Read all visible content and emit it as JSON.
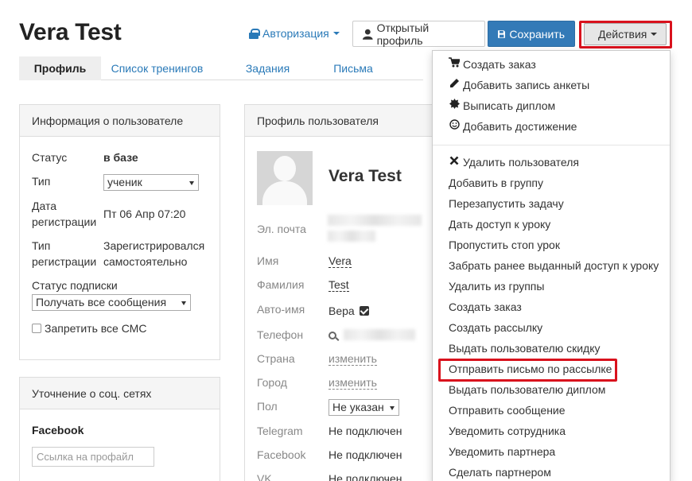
{
  "header": {
    "title": "Vera Test",
    "auth_label": "Авторизация",
    "open_profile_label": "Открытый профиль",
    "save_label": "Сохранить",
    "actions_label": "Действия"
  },
  "tabs": [
    {
      "label": "Профиль",
      "active": true
    },
    {
      "label": "Список тренингов",
      "active": false
    },
    {
      "label": "Задания",
      "active": false
    },
    {
      "label": "Письма",
      "active": false
    }
  ],
  "user_info": {
    "heading": "Информация о пользователе",
    "status_label": "Статус",
    "status_value": "в базе",
    "type_label": "Тип",
    "type_value": "ученик",
    "reg_date_label_1": "Дата",
    "reg_date_label_2": "регистрации",
    "reg_date_value": "Пт 06 Апр 07:20",
    "reg_type_label_1": "Тип",
    "reg_type_label_2": "регистрации",
    "reg_type_value_1": "Зарегистрировался",
    "reg_type_value_2": "самостоятельно",
    "subscription_label": "Статус подписки",
    "subscription_value": "Получать все сообщения",
    "no_sms_label": "Запретить все СМС"
  },
  "social": {
    "heading": "Уточнение о соц. сетях",
    "facebook_label": "Facebook",
    "facebook_placeholder": "Ссылка на профайл"
  },
  "profile": {
    "heading": "Профиль пользователя",
    "name": "Vera Test",
    "email_label": "Эл. почта",
    "first_name_label": "Имя",
    "first_name_value": "Vera",
    "last_name_label": "Фамилия",
    "last_name_value": "Test",
    "auto_name_label": "Авто-имя",
    "auto_name_value": "Вера",
    "phone_label": "Телефон",
    "country_label": "Страна",
    "country_value": "изменить",
    "city_label": "Город",
    "city_value": "изменить",
    "gender_label": "Пол",
    "gender_value": "Не указан",
    "telegram_label": "Telegram",
    "telegram_value": "Не подключен",
    "facebook_label": "Facebook",
    "facebook_value": "Не подключен",
    "vk_label": "VK",
    "vk_value": "Не подключен"
  },
  "actions_menu": {
    "group1": [
      {
        "label": "Создать заказ",
        "icon": "cart-icon"
      },
      {
        "label": "Добавить запись анкеты",
        "icon": "pencil-icon"
      },
      {
        "label": "Выписать диплом",
        "icon": "certificate-icon"
      },
      {
        "label": "Добавить достижение",
        "icon": "smile-icon"
      }
    ],
    "group2": [
      {
        "label": "Удалить пользователя",
        "icon": "close-icon"
      },
      {
        "label": "Добавить в группу"
      },
      {
        "label": "Перезапустить задачу"
      },
      {
        "label": "Дать доступ к уроку"
      },
      {
        "label": "Пропустить стоп урок"
      },
      {
        "label": "Забрать ранее выданный доступ к уроку"
      },
      {
        "label": "Удалить из группы"
      },
      {
        "label": "Создать заказ"
      },
      {
        "label": "Создать рассылку"
      },
      {
        "label": "Выдать пользователю скидку"
      },
      {
        "label": "Отправить письмо по рассылке",
        "highlighted": true
      },
      {
        "label": "Выдать пользователю диплом"
      },
      {
        "label": "Отправить сообщение"
      },
      {
        "label": "Уведомить сотрудника"
      },
      {
        "label": "Уведомить партнера"
      },
      {
        "label": "Сделать партнером"
      }
    ]
  },
  "colors": {
    "link": "#2a7ab8",
    "primary": "#337ab7",
    "highlight": "#d9121d"
  }
}
